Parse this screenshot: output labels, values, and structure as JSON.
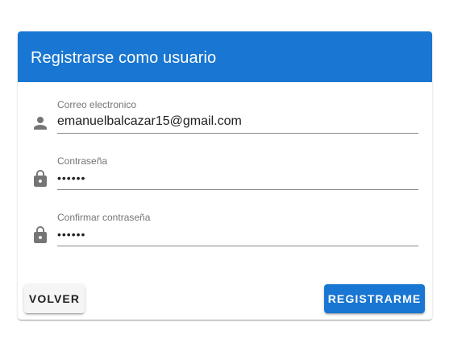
{
  "form": {
    "title": "Registrarse como usuario",
    "fields": [
      {
        "label": "Correo electronico",
        "value": "emanuelbalcazar15@gmail.com",
        "type": "email",
        "icon": "person-icon"
      },
      {
        "label": "Contraseña",
        "value": "••••••",
        "type": "password",
        "icon": "lock-icon"
      },
      {
        "label": "Confirmar contraseña",
        "value": "••••••",
        "type": "password",
        "icon": "lock-icon"
      }
    ],
    "buttons": {
      "back_label": "VOLVER",
      "register_label": "REGISTRARME"
    }
  },
  "colors": {
    "primary": "#1976d2",
    "icon": "#757575",
    "label": "#757575",
    "text": "#212121",
    "underline": "#8a8a8a",
    "back_button_bg": "#f5f5f5"
  }
}
